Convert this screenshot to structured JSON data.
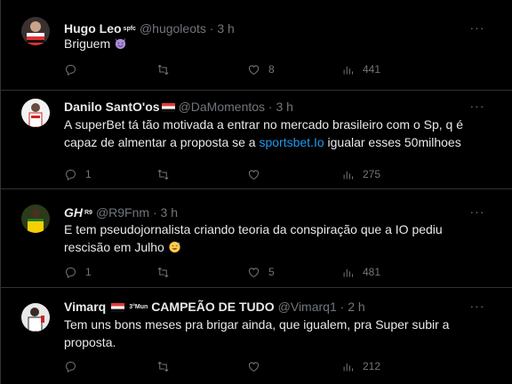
{
  "more_glyph": "···",
  "tweets": [
    {
      "display_name": "Hugo Leo",
      "badge": "spfc",
      "handle": "@hugoleots",
      "sep": " · ",
      "time": "3 h",
      "text": "Briguem",
      "emoji": "smiling-devil",
      "replies": "",
      "retweets": "",
      "likes": "8",
      "views": "441"
    },
    {
      "display_name": "Danilo SantO'os",
      "handle": "@DaMomentos",
      "sep": " · ",
      "time": "3 h",
      "text_before": "A superBet tá tão motivada a entrar no mercado brasileiro com o Sp, q é capaz de almentar a proposta se a ",
      "link": "sportsbet.Io",
      "text_after": " igualar esses 50milhoes",
      "replies": "1",
      "retweets": "",
      "likes": "",
      "views": "275"
    },
    {
      "display_name": "GH",
      "badge": "R9",
      "handle": "@R9Fnm",
      "sep": " · ",
      "time": "3 h",
      "text": "E tem pseudojornalista criando teoria da conspiração que a IO pediu rescisão em Julho",
      "emoji": "sweat-smile",
      "replies": "1",
      "retweets": "",
      "likes": "5",
      "views": "481"
    },
    {
      "display_name": "Vimarq",
      "name_suffix": "CAMPEÃO DE TUDO",
      "badge": "3°Mun",
      "handle": "@Vimarq1",
      "sep": " · ",
      "time": "2 h",
      "text": "Tem uns bons meses pra brigar ainda, que igualem, pra Super subir a proposta.",
      "replies": "",
      "retweets": "",
      "likes": "",
      "views": "212"
    }
  ],
  "colors": {
    "background": "#000000",
    "text": "#e7e9ea",
    "muted": "#71767b",
    "link": "#1d9bf0",
    "divider": "#2f3336"
  },
  "icons": [
    "reply-icon",
    "retweet-icon",
    "like-icon",
    "views-icon",
    "more-icon",
    "flag-icon"
  ]
}
